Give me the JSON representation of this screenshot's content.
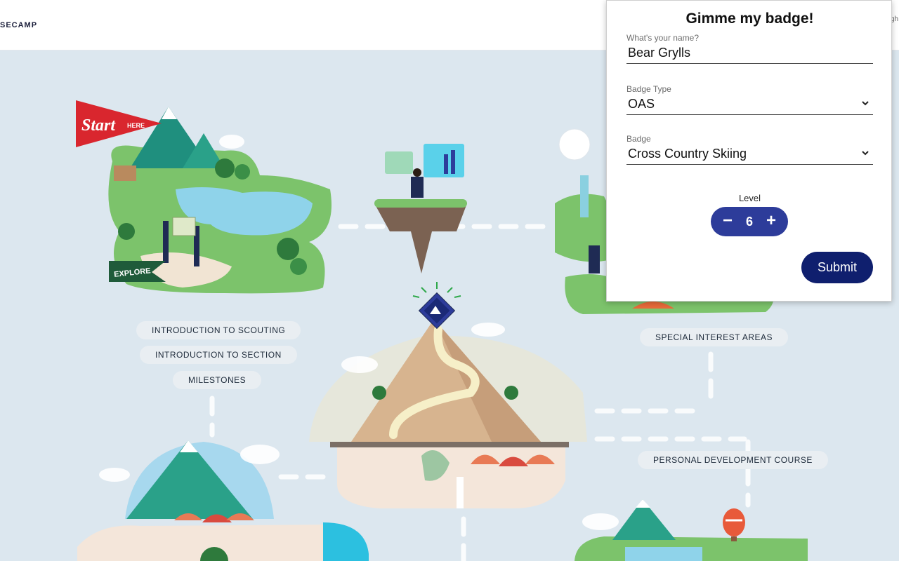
{
  "header": {
    "brand": "SECAMP",
    "corner_text": "gh"
  },
  "map": {
    "start_flag": {
      "start": "Start",
      "here": "HERE"
    },
    "explore_flag": "EXPLORE",
    "labels": {
      "intro_scouting": "INTRODUCTION TO SCOUTING",
      "intro_section": "INTRODUCTION TO SECTION",
      "milestones": "MILESTONES",
      "special_interest": "SPECIAL INTEREST AREAS",
      "personal_dev": "PERSONAL DEVELOPMENT COURSE"
    }
  },
  "badge_form": {
    "title": "Gimme my badge!",
    "name_label": "What's your name?",
    "name_value": "Bear Grylls",
    "type_label": "Badge Type",
    "type_value": "OAS",
    "badge_label": "Badge",
    "badge_value": "Cross Country Skiing",
    "level_label": "Level",
    "level_value": "6",
    "minus": "−",
    "plus": "+",
    "submit_label": "Submit"
  },
  "colors": {
    "primary": "#2d3c9a",
    "submit": "#0f1f6e",
    "flag_red": "#d9262e",
    "explore_green": "#1f5b3a",
    "background": "#dce7ef"
  }
}
